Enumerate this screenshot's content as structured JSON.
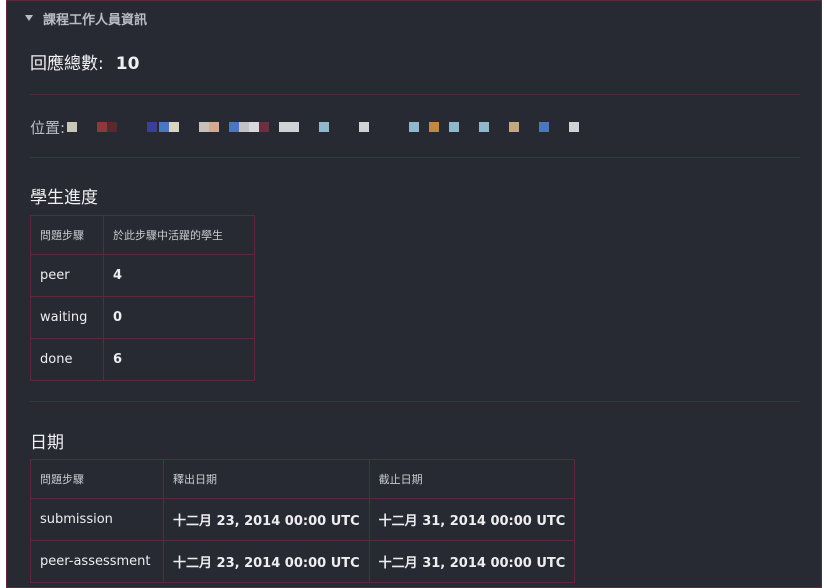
{
  "header": {
    "title": "課程工作人員資訊",
    "caret_icon": "caret-down-icon"
  },
  "responses": {
    "label": "回應總數:",
    "count": "10"
  },
  "location": {
    "label": "位置:",
    "pixel_colors": [
      "#c8c6b6",
      "#8b3a3a",
      "#5a2830",
      "#3a3f9a",
      "#4a78c0",
      "#d8d4c4",
      "#c8c0b8",
      "#d6a890",
      "#4a78c0",
      "#c0c0c8",
      "#d8d8dc",
      "#6a3040",
      "#d0d2d6",
      "#d0d2d6",
      "#8fb8cc",
      "#d0d2d6",
      "#8fb8cc",
      "#c08840",
      "#8fb8cc",
      "#8fb8cc",
      "#c4a880",
      "#4a78c0",
      "#d0d2d6"
    ]
  },
  "progress": {
    "title": "學生進度",
    "headers": [
      "問題步驟",
      "於此步驟中活躍的學生"
    ],
    "rows": [
      {
        "step": "peer",
        "count": "4"
      },
      {
        "step": "waiting",
        "count": "0"
      },
      {
        "step": "done",
        "count": "6"
      }
    ]
  },
  "dates": {
    "title": "日期",
    "headers": [
      "問題步驟",
      "釋出日期",
      "截止日期"
    ],
    "rows": [
      {
        "step": "submission",
        "release": "十二月 23, 2014 00:00 UTC",
        "due": "十二月 31, 2014 00:00 UTC"
      },
      {
        "step": "peer-assessment",
        "release": "十二月 23, 2014 00:00 UTC",
        "due": "十二月 31, 2014 00:00 UTC"
      }
    ]
  },
  "colors": {
    "panel_bg": "#272a32",
    "border": "#5b2b3a",
    "text": "#e8e8ea",
    "muted": "#b9bcc6"
  }
}
